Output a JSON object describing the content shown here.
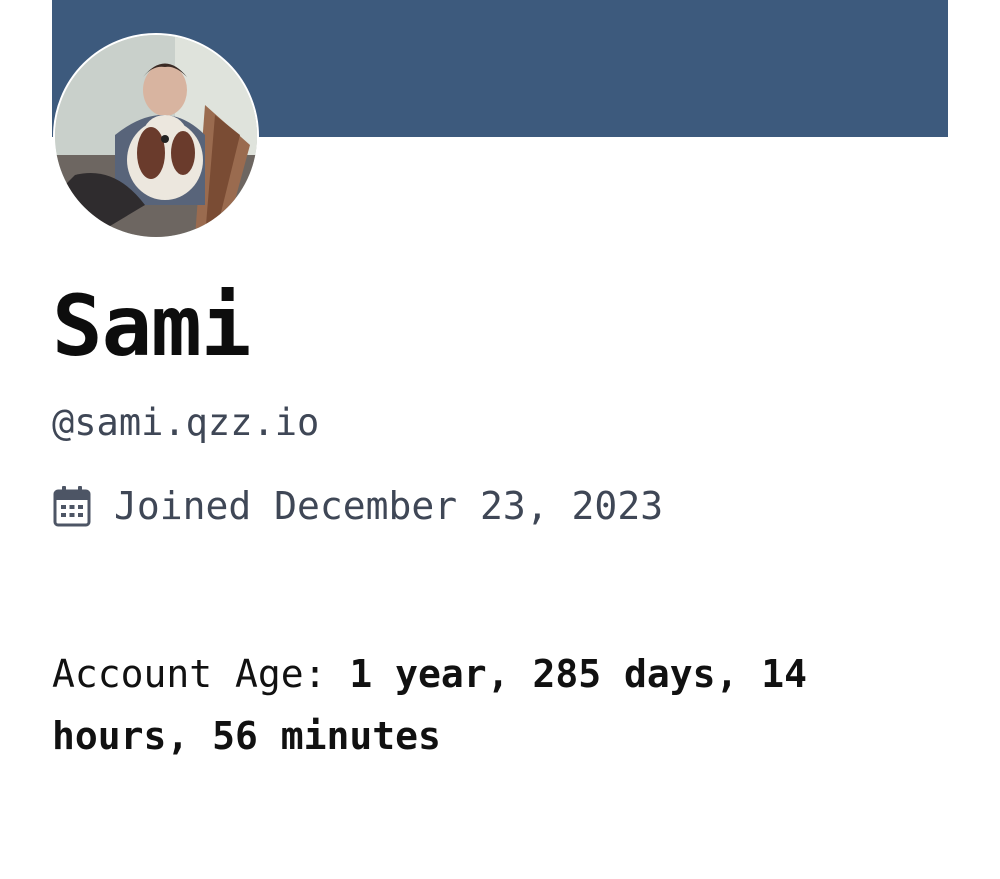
{
  "profile": {
    "display_name": "Sami",
    "handle": "@sami.qzz.io",
    "joined": "Joined December 23, 2023",
    "account_age_label": "Account Age: ",
    "account_age_value": "1 year, 285 days, 14 hours, 56 minutes"
  },
  "colors": {
    "banner": "#3d5a7d",
    "muted_text": "#3f4756",
    "primary_text": "#111111"
  },
  "icons": {
    "joined": "calendar-icon"
  }
}
